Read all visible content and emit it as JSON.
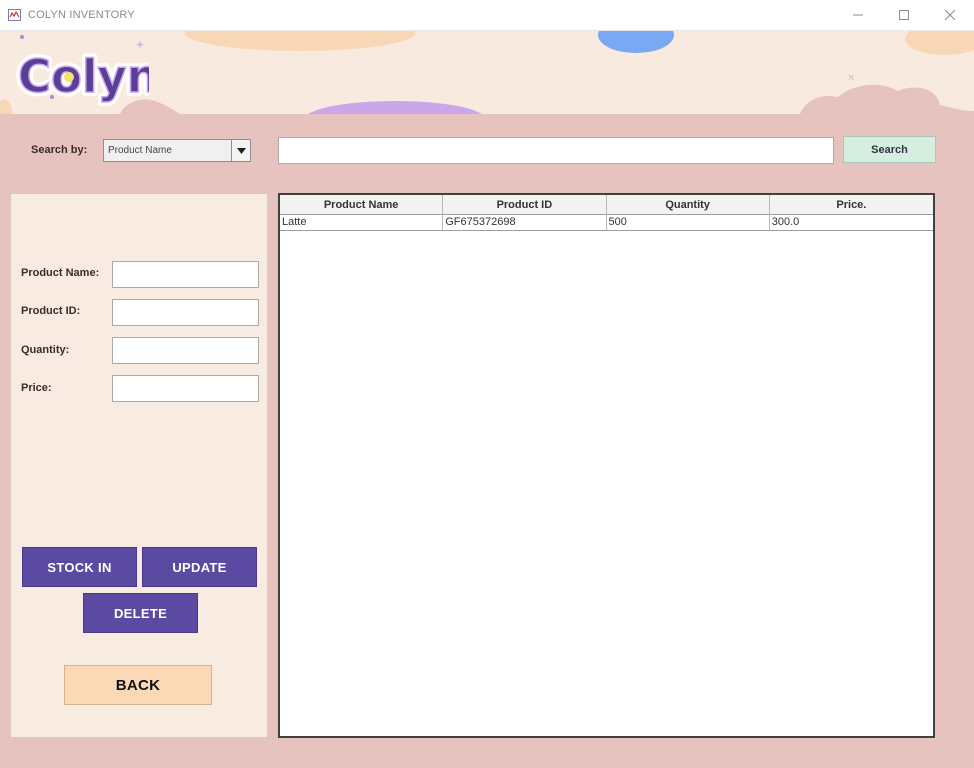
{
  "window": {
    "title": "COLYN INVENTORY",
    "minimize_icon": "minimize-icon",
    "maximize_icon": "maximize-icon",
    "close_icon": "close-icon"
  },
  "banner": {
    "logo_text": "Colyn"
  },
  "search": {
    "label": "Search by:",
    "selected_option": "Product Name",
    "query": "",
    "button_label": "Search"
  },
  "form": {
    "product_name_label": "Product Name:",
    "product_id_label": "Product ID:",
    "quantity_label": "Quantity:",
    "price_label": "Price:",
    "product_name_value": "",
    "product_id_value": "",
    "quantity_value": "",
    "price_value": ""
  },
  "actions": {
    "stock_in": "STOCK IN",
    "update": "UPDATE",
    "delete": "DELETE",
    "back": "BACK"
  },
  "table": {
    "columns": [
      "Product Name",
      "Product ID",
      "Quantity",
      "Price."
    ],
    "rows": [
      [
        "Latte",
        "GF675372698",
        "500",
        "300.0"
      ]
    ]
  },
  "colors": {
    "accent_purple": "#5b4aa2",
    "background_pink": "#e7c3bf",
    "panel_cream": "#f8ece2",
    "search_button": "#d4efe0",
    "back_button": "#fbd9b6"
  }
}
